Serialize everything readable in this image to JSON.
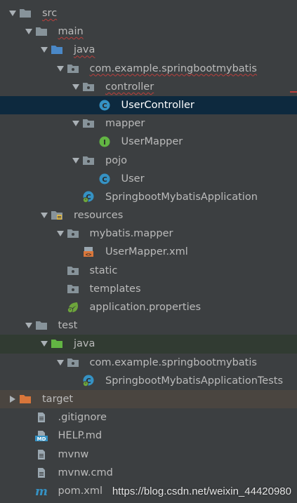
{
  "tree": [
    {
      "label": "src",
      "depth": 0,
      "arrow": "down",
      "icon": "folder",
      "squiggle": true
    },
    {
      "label": "main",
      "depth": 1,
      "arrow": "down",
      "icon": "folder",
      "squiggle": true
    },
    {
      "label": "java",
      "depth": 2,
      "arrow": "down",
      "icon": "source-folder",
      "squiggle": true
    },
    {
      "label": "com.example.springbootmybatis",
      "depth": 3,
      "arrow": "down",
      "icon": "package",
      "squiggle": true
    },
    {
      "label": "controller",
      "depth": 4,
      "arrow": "down",
      "icon": "package",
      "squiggle": true
    },
    {
      "label": "UserController",
      "depth": 5,
      "arrow": "none",
      "icon": "class",
      "selected": true
    },
    {
      "label": "mapper",
      "depth": 4,
      "arrow": "down",
      "icon": "package"
    },
    {
      "label": "UserMapper",
      "depth": 5,
      "arrow": "none",
      "icon": "interface"
    },
    {
      "label": "pojo",
      "depth": 4,
      "arrow": "down",
      "icon": "package"
    },
    {
      "label": "User",
      "depth": 5,
      "arrow": "none",
      "icon": "class"
    },
    {
      "label": "SpringbootMybatisApplication",
      "depth": 4,
      "arrow": "none",
      "icon": "spring-class"
    },
    {
      "label": "resources",
      "depth": 2,
      "arrow": "down",
      "icon": "resources-folder"
    },
    {
      "label": "mybatis.mapper",
      "depth": 3,
      "arrow": "down",
      "icon": "package"
    },
    {
      "label": "UserMapper.xml",
      "depth": 4,
      "arrow": "none",
      "icon": "xml-file"
    },
    {
      "label": "static",
      "depth": 3,
      "arrow": "none",
      "icon": "package"
    },
    {
      "label": "templates",
      "depth": 3,
      "arrow": "none",
      "icon": "package"
    },
    {
      "label": "application.properties",
      "depth": 3,
      "arrow": "none",
      "icon": "spring-properties"
    },
    {
      "label": "test",
      "depth": 1,
      "arrow": "down",
      "icon": "folder"
    },
    {
      "label": "java",
      "depth": 2,
      "arrow": "down",
      "icon": "test-folder",
      "bg": "test"
    },
    {
      "label": "com.example.springbootmybatis",
      "depth": 3,
      "arrow": "down",
      "icon": "package"
    },
    {
      "label": "SpringbootMybatisApplicationTests",
      "depth": 4,
      "arrow": "none",
      "icon": "spring-class"
    },
    {
      "label": "target",
      "depth": 0,
      "arrow": "right",
      "icon": "excluded-folder",
      "bg": "excluded"
    },
    {
      "label": ".gitignore",
      "depth": 1,
      "arrow": "none",
      "icon": "text-file"
    },
    {
      "label": "HELP.md",
      "depth": 1,
      "arrow": "none",
      "icon": "md-file"
    },
    {
      "label": "mvnw",
      "depth": 1,
      "arrow": "none",
      "icon": "text-file"
    },
    {
      "label": "mvnw.cmd",
      "depth": 1,
      "arrow": "none",
      "icon": "text-file"
    },
    {
      "label": "pom.xml",
      "depth": 1,
      "arrow": "none",
      "icon": "maven-file"
    }
  ],
  "watermark": "https://blog.csdn.net/weixin_44420980",
  "colors": {
    "background": "#3c3f41",
    "selection": "#0d293e",
    "test_background": "#313b32",
    "excluded_background": "#4a4540",
    "text": "#bbbbbb"
  }
}
